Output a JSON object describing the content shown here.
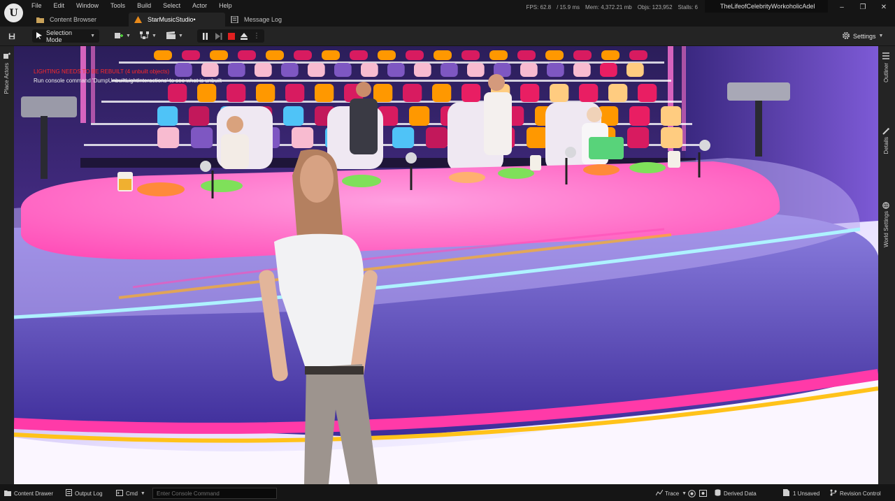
{
  "menu": [
    "File",
    "Edit",
    "Window",
    "Tools",
    "Build",
    "Select",
    "Actor",
    "Help"
  ],
  "tabs": [
    {
      "label": "Content Browser",
      "icon": "folder-icon"
    },
    {
      "label": "StarMusicStudio•",
      "icon": "level-icon"
    },
    {
      "label": "Message Log",
      "icon": "log-icon"
    }
  ],
  "stats": {
    "fps": "FPS: 62.8",
    "ms": "/ 15.9 ms",
    "mem": "Mem: 4,372.21 mb",
    "objs": "Objs: 123,952",
    "stalls": "Stalls: 6"
  },
  "project_name": "TheLifeofCelebrityWorkoholicAdel",
  "toolbar": {
    "selection_mode": "Selection Mode",
    "settings": "Settings"
  },
  "side_panels": {
    "left": "Place Actors",
    "right": [
      "Outliner",
      "Details",
      "World Settings"
    ]
  },
  "viewport": {
    "warning": "LIGHTING NEEDS TO BE REBUILT (4 unbuilt objects)",
    "hint": "Run console command 'DumpUnbuiltLightInteractions' to see what is unbuilt"
  },
  "bottombar": {
    "content_drawer": "Content Drawer",
    "output_log": "Output Log",
    "cmd": "Cmd",
    "cmd_placeholder": "Enter Console Command",
    "trace": "Trace",
    "derived_data": "Derived Data",
    "unsaved": "1 Unsaved",
    "revision_control": "Revision Control"
  },
  "colors": {
    "accent": "#e0306a",
    "stop_red": "#e02020",
    "warning": "#ff2a2a",
    "table_pink": "#ff5fc4"
  }
}
